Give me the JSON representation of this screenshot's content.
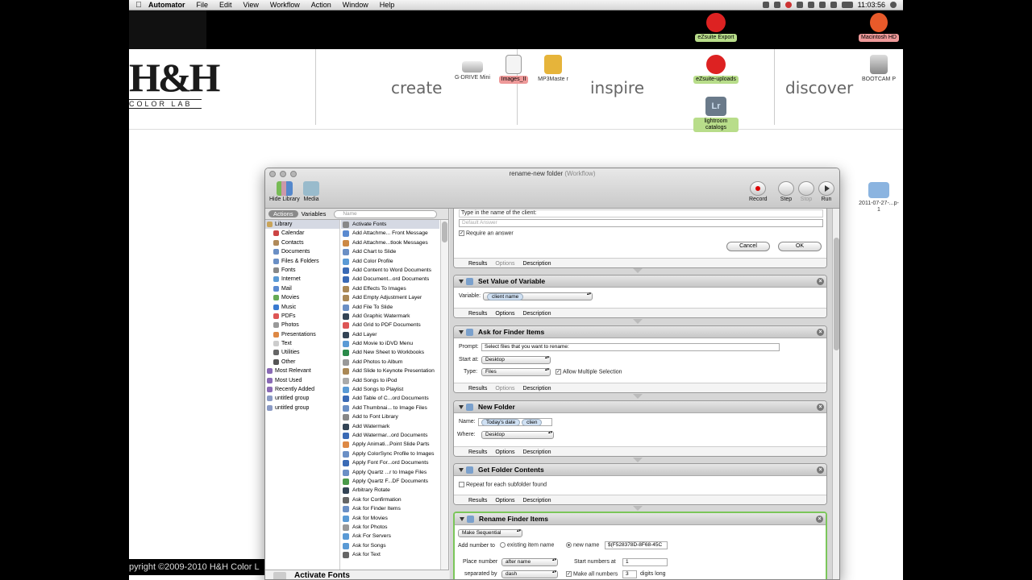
{
  "menubar": {
    "app_name": "Automator",
    "menus": [
      "File",
      "Edit",
      "View",
      "Workflow",
      "Action",
      "Window",
      "Help"
    ],
    "clock": "11:03:56"
  },
  "website": {
    "logo_main": "H&H",
    "logo_sub": "COLOR LAB",
    "nav": [
      "create",
      "inspire",
      "discover"
    ],
    "footer": "pyright ©2009-2010 H&H Color L"
  },
  "desktop_icons": [
    {
      "name": "G-DRIVE Mini",
      "label_class": "plain"
    },
    {
      "name": "Images_II",
      "label_class": "red"
    },
    {
      "name": "MP3Maste r",
      "label_class": "plain"
    },
    {
      "name": "eZsuite Export",
      "label_class": "green"
    },
    {
      "name": "eZsuite-uploads",
      "label_class": "green"
    },
    {
      "name": "lightroom catalogs",
      "label_class": "green"
    },
    {
      "name": "Macintosh HD",
      "label_class": "red"
    },
    {
      "name": "BOOTCAM P",
      "label_class": "plain"
    },
    {
      "name": "2011-07-27-...p-1",
      "label_class": "plain"
    }
  ],
  "window": {
    "title": "rename-new folder",
    "title_suffix": "(Workflow)",
    "toolbar": {
      "hide_library": "Hide Library",
      "media": "Media",
      "record": "Record",
      "step": "Step",
      "stop": "Stop",
      "run": "Run"
    },
    "tabs": {
      "actions": "Actions",
      "variables": "Variables",
      "search_placeholder": "Name"
    },
    "library": [
      {
        "label": "Library",
        "top": true,
        "color": "#c9a45a"
      },
      {
        "label": "Calendar",
        "color": "#c44"
      },
      {
        "label": "Contacts",
        "color": "#b08a5a"
      },
      {
        "label": "Documents",
        "color": "#6a8fc5"
      },
      {
        "label": "Files & Folders",
        "color": "#6a8fc5"
      },
      {
        "label": "Fonts",
        "color": "#888"
      },
      {
        "label": "Internet",
        "color": "#5a9ad5"
      },
      {
        "label": "Mail",
        "color": "#5a8ad0"
      },
      {
        "label": "Movies",
        "color": "#6a5"
      },
      {
        "label": "Music",
        "color": "#3a7ad0"
      },
      {
        "label": "PDFs",
        "color": "#d55"
      },
      {
        "label": "Photos",
        "color": "#999"
      },
      {
        "label": "Presentations",
        "color": "#d84"
      },
      {
        "label": "Text",
        "color": "#ccc"
      },
      {
        "label": "Utilities",
        "color": "#666"
      },
      {
        "label": "Other",
        "color": "#555"
      },
      {
        "label": "Most Relevant",
        "top": true,
        "color": "#8a6ab5"
      },
      {
        "label": "Most Used",
        "top": true,
        "color": "#8a6ab5"
      },
      {
        "label": "Recently Added",
        "top": true,
        "color": "#8a6ab5"
      },
      {
        "label": "untitled group",
        "top": true,
        "color": "#8a9ac5"
      },
      {
        "label": "untitled group",
        "top": true,
        "color": "#8a9ac5"
      }
    ],
    "actions": [
      {
        "label": "Activate Fonts",
        "color": "#888",
        "selected": true
      },
      {
        "label": "Add Attachme... Front Message",
        "color": "#5a8ad0"
      },
      {
        "label": "Add Attachme...tlook Messages",
        "color": "#c84"
      },
      {
        "label": "Add Chart to Slide",
        "color": "#6a8fc5"
      },
      {
        "label": "Add Color Profile",
        "color": "#5a9ad5"
      },
      {
        "label": "Add Content to Word Documents",
        "color": "#3a6ab5"
      },
      {
        "label": "Add Document...ord Documents",
        "color": "#3a6ab5"
      },
      {
        "label": "Add Effects To Images",
        "color": "#a85"
      },
      {
        "label": "Add Empty Adjustment Layer",
        "color": "#a85"
      },
      {
        "label": "Add File To Slide",
        "color": "#6a8fc5"
      },
      {
        "label": "Add Graphic Watermark",
        "color": "#345"
      },
      {
        "label": "Add Grid to PDF Documents",
        "color": "#d55"
      },
      {
        "label": "Add Layer",
        "color": "#345"
      },
      {
        "label": "Add Movie to iDVD Menu",
        "color": "#5a9ad5"
      },
      {
        "label": "Add New Sheet to Workbooks",
        "color": "#2a8a4a"
      },
      {
        "label": "Add Photos to Album",
        "color": "#999"
      },
      {
        "label": "Add Slide to Keynote Presentation",
        "color": "#a85"
      },
      {
        "label": "Add Songs to iPod",
        "color": "#aaa"
      },
      {
        "label": "Add Songs to Playlist",
        "color": "#5a9ad5"
      },
      {
        "label": "Add Table of C...ord Documents",
        "color": "#3a6ab5"
      },
      {
        "label": "Add Thumbnai... to Image Files",
        "color": "#6a8fc5"
      },
      {
        "label": "Add to Font Library",
        "color": "#888"
      },
      {
        "label": "Add Watermark",
        "color": "#345"
      },
      {
        "label": "Add Watermar...ord Documents",
        "color": "#3a6ab5"
      },
      {
        "label": "Apply Animati...Point Slide Parts",
        "color": "#d84"
      },
      {
        "label": "Apply ColorSync Profile to Images",
        "color": "#6a8fc5"
      },
      {
        "label": "Apply Font For...ord Documents",
        "color": "#3a6ab5"
      },
      {
        "label": "Apply Quartz ...r to Image Files",
        "color": "#6a8fc5"
      },
      {
        "label": "Apply Quartz F...DF Documents",
        "color": "#4a9a4a"
      },
      {
        "label": "Arbitrary Rotate",
        "color": "#345"
      },
      {
        "label": "Ask for Confirmation",
        "color": "#666"
      },
      {
        "label": "Ask for Finder Items",
        "color": "#6a8fc5"
      },
      {
        "label": "Ask for Movies",
        "color": "#5a9ad5"
      },
      {
        "label": "Ask for Photos",
        "color": "#999"
      },
      {
        "label": "Ask For Servers",
        "color": "#5a9ad5"
      },
      {
        "label": "Ask for Songs",
        "color": "#5a9ad5"
      },
      {
        "label": "Ask for Text",
        "color": "#666"
      }
    ],
    "description_title": "Activate Fonts",
    "workflow": {
      "ask_text": {
        "prompt": "Type in the name of the client:",
        "default_placeholder": "Default Answer",
        "require": "Require an answer",
        "cancel": "Cancel",
        "ok": "OK"
      },
      "footer_tabs": [
        "Results",
        "Options",
        "Description"
      ],
      "set_variable": {
        "title": "Set Value of Variable",
        "variable_label": "Variable:",
        "variable_value": "client name"
      },
      "ask_finder": {
        "title": "Ask for Finder Items",
        "prompt_label": "Prompt:",
        "prompt_value": "Select files that you want to rename:",
        "start_label": "Start at:",
        "start_value": "Desktop",
        "type_label": "Type:",
        "type_value": "Files",
        "multi": "Allow Multiple Selection"
      },
      "new_folder": {
        "title": "New Folder",
        "name_label": "Name:",
        "token1": "Today's date",
        "token2": "clien",
        "where_label": "Where:",
        "where_value": "Desktop"
      },
      "folder_contents": {
        "title": "Get Folder Contents",
        "repeat": "Repeat for each subfolder found"
      },
      "rename": {
        "title": "Rename Finder Items",
        "mode": "Make Sequential",
        "add_number_label": "Add number to",
        "existing": "existing item name",
        "new_name": "new name",
        "new_name_value": "$(F528378D-8F68-45C",
        "place_label": "Place number",
        "place_value": "after name",
        "start_label": "Start numbers at",
        "start_value": "1",
        "sep_label": "separated by",
        "sep_value": "dash",
        "make_all": "Make all numbers",
        "digits_value": "3",
        "digits_label": "digits long"
      }
    }
  }
}
